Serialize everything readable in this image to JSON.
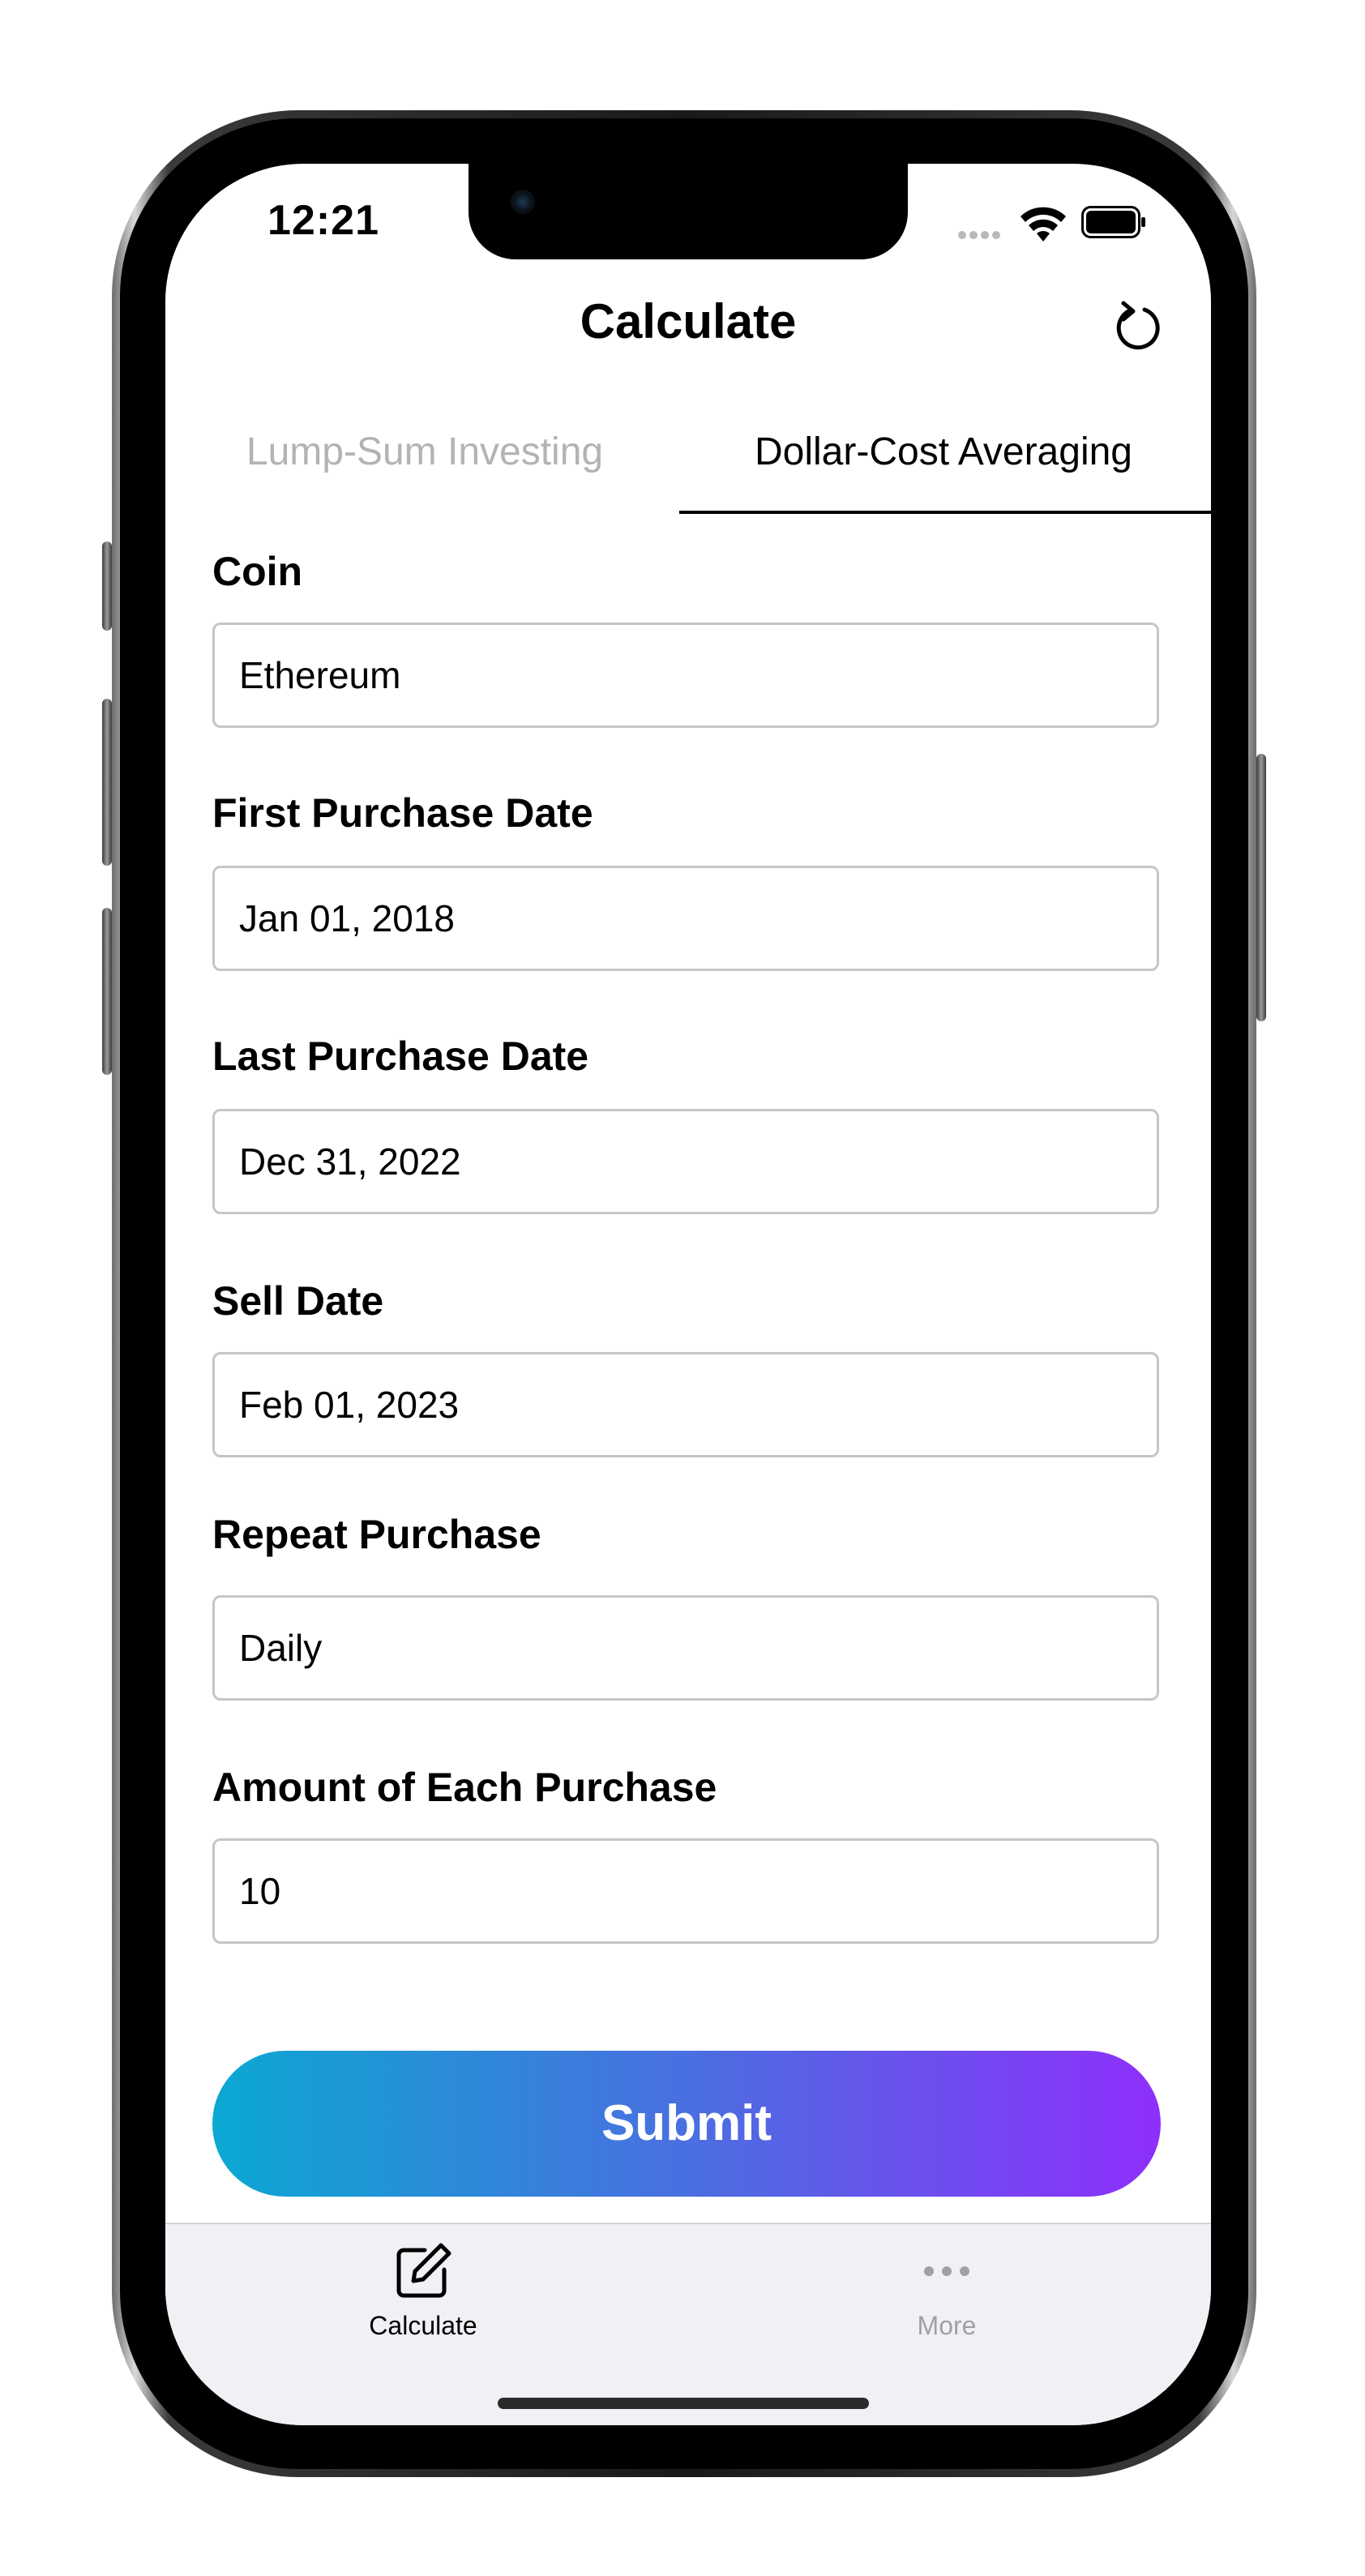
{
  "status_bar": {
    "time": "12:21"
  },
  "nav": {
    "title": "Calculate",
    "reset_icon": "reset-icon"
  },
  "tabs": [
    {
      "label": "Lump-Sum Investing",
      "selected": false
    },
    {
      "label": "Dollar-Cost Averaging",
      "selected": true
    }
  ],
  "form": {
    "coin": {
      "label": "Coin",
      "value": "Ethereum"
    },
    "first_purchase": {
      "label": "First Purchase Date",
      "value": "Jan 01, 2018"
    },
    "last_purchase": {
      "label": "Last Purchase Date",
      "value": "Dec 31, 2022"
    },
    "sell_date": {
      "label": "Sell Date",
      "value": "Feb 01, 2023"
    },
    "repeat_purchase": {
      "label": "Repeat Purchase",
      "value": "Daily"
    },
    "amount": {
      "label": "Amount of Each Purchase",
      "value": "10"
    }
  },
  "submit_label": "Submit",
  "colors": {
    "gradient_start": "#0ba8d2",
    "gradient_mid": "#4a6fe0",
    "gradient_end": "#8e2ffc",
    "inactive_tab": "#b3b3b3"
  },
  "tab_bar": {
    "items": [
      {
        "label": "Calculate",
        "icon": "edit-icon",
        "selected": true
      },
      {
        "label": "More",
        "icon": "more-icon",
        "selected": false
      }
    ]
  }
}
